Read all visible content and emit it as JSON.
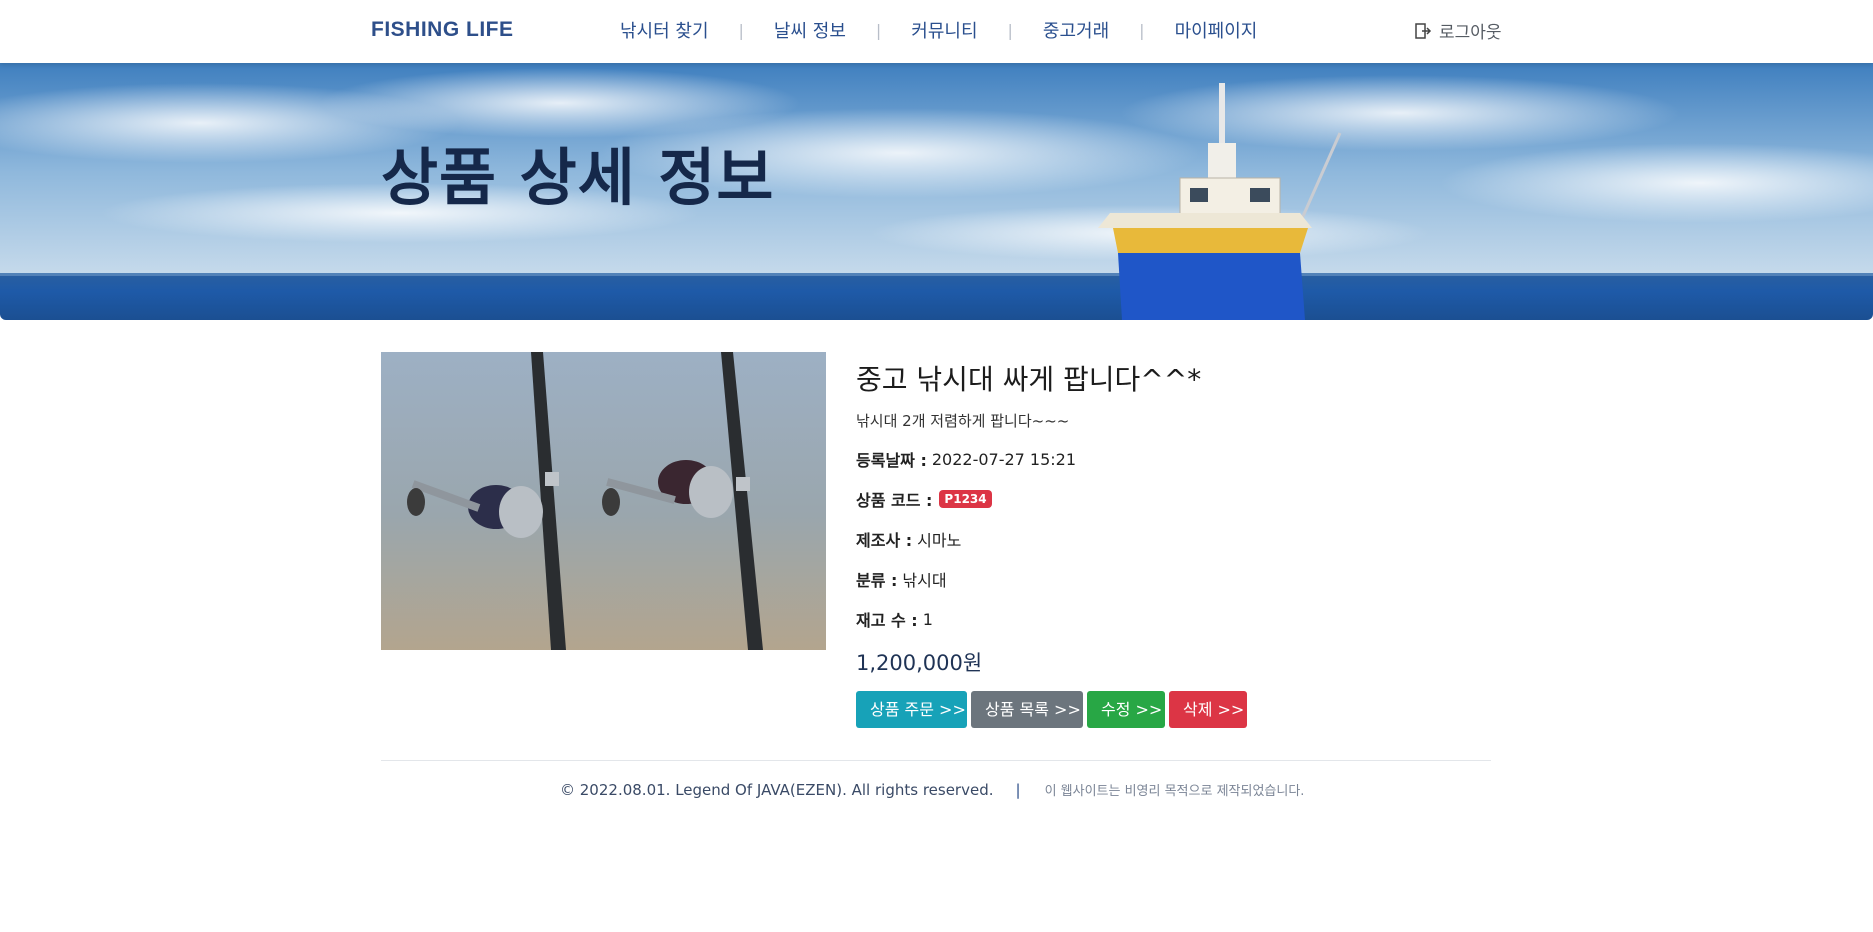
{
  "header": {
    "brand": "FISHING LIFE",
    "menu": [
      {
        "label": "낚시터 찾기"
      },
      {
        "label": "날씨 정보"
      },
      {
        "label": "커뮤니티"
      },
      {
        "label": "중고거래"
      },
      {
        "label": "마이페이지"
      }
    ],
    "logout_label": "로그아웃",
    "logout_icon": "logout-icon"
  },
  "banner": {
    "title": "상품 상세 정보"
  },
  "product": {
    "title": "중고 낚시대 싸게 팝니다^^*",
    "description": "낚시대 2개 저렴하게 팝니다~~~",
    "date_label": "등록날짜 :",
    "date_value": "2022-07-27 15:21",
    "code_label": "상품 코드 :",
    "code_value": "P1234",
    "maker_label": "제조사 :",
    "maker_value": "시마노",
    "category_label": "분류 :",
    "category_value": "낚시대",
    "stock_label": "재고 수 :",
    "stock_value": "1",
    "price": "1,200,000원"
  },
  "actions": {
    "order": "상품 주문 >>",
    "list": "상품 목록 >>",
    "edit": "수정 >>",
    "delete": "삭제 >>"
  },
  "footer": {
    "copyright": "© 2022.08.01.  Legend Of JAVA(EZEN).  All rights reserved.",
    "separator": "|",
    "note": "이 웹사이트는 비영리 목적으로 제작되었습니다."
  },
  "colors": {
    "brand": "#2e4f8a",
    "info": "#17a2b8",
    "secondary": "#6c757d",
    "success": "#28a745",
    "danger": "#dc3545"
  }
}
